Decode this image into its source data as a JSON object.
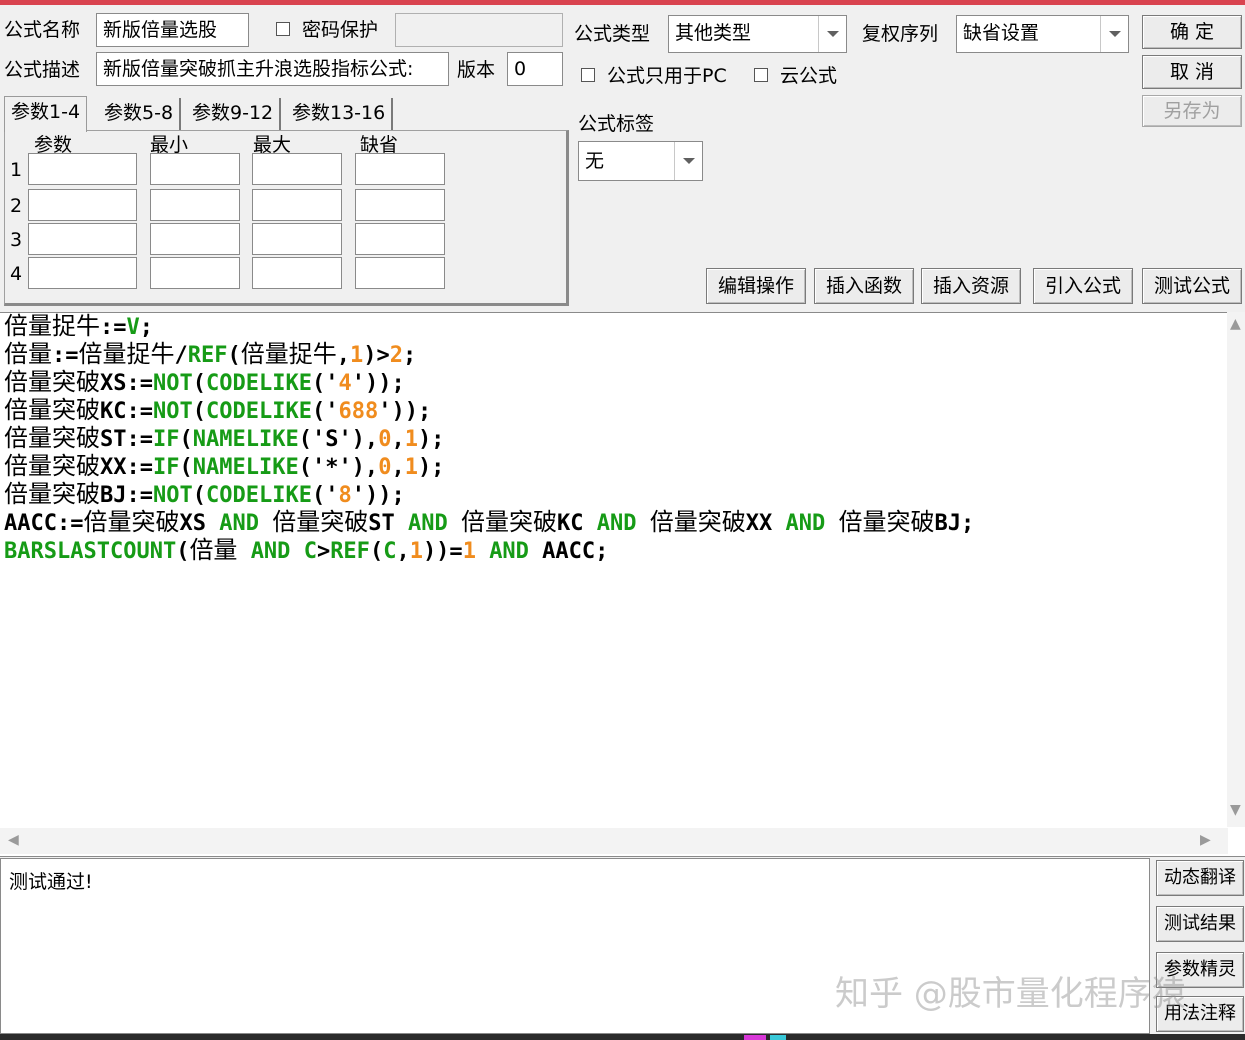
{
  "header": {
    "name_label": "公式名称",
    "name_value": "新版倍量选股",
    "password_label": "密码保护",
    "password_value": "",
    "desc_label": "公式描述",
    "desc_value": "新版倍量突破抓主升浪选股指标公式:",
    "version_label": "版本",
    "version_value": "0",
    "type_label": "公式类型",
    "type_value": "其他类型",
    "restore_label": "复权序列",
    "restore_value": "缺省设置",
    "pc_only_label": "公式只用于PC",
    "cloud_label": "云公式",
    "tag_label": "公式标签",
    "tag_value": "无"
  },
  "buttons": {
    "ok": "确 定",
    "cancel": "取 消",
    "save_as": "另存为",
    "edit_ops": "编辑操作",
    "insert_func": "插入函数",
    "insert_res": "插入资源",
    "import_formula": "引入公式",
    "test_formula": "测试公式",
    "dyn_translate": "动态翻译",
    "test_result": "测试结果",
    "param_wizard": "参数精灵",
    "usage_notes": "用法注释"
  },
  "param_tabs": [
    "参数1-4",
    "参数5-8",
    "参数9-12",
    "参数13-16"
  ],
  "param_columns": [
    "参数",
    "最小",
    "最大",
    "缺省"
  ],
  "param_rows": [
    "1",
    "2",
    "3",
    "4"
  ],
  "code_lines": [
    [
      [
        "c",
        "倍量捉牛"
      ],
      [
        "k",
        ":="
      ],
      [
        "g",
        "V"
      ],
      [
        "k",
        ";"
      ]
    ],
    [
      [
        "c",
        "倍量"
      ],
      [
        "k",
        ":="
      ],
      [
        "c",
        "倍量捉牛"
      ],
      [
        "k",
        "/"
      ],
      [
        "g",
        "REF"
      ],
      [
        "k",
        "("
      ],
      [
        "c",
        "倍量捉牛"
      ],
      [
        "k",
        ","
      ],
      [
        "o",
        "1"
      ],
      [
        "k",
        ")>"
      ],
      [
        "o",
        "2"
      ],
      [
        "k",
        ";"
      ]
    ],
    [
      [
        "c",
        "倍量突破"
      ],
      [
        "k",
        "XS:="
      ],
      [
        "g",
        "NOT"
      ],
      [
        "k",
        "("
      ],
      [
        "g",
        "CODELIKE"
      ],
      [
        "k",
        "('"
      ],
      [
        "o",
        "4"
      ],
      [
        "k",
        "'));"
      ]
    ],
    [
      [
        "c",
        "倍量突破"
      ],
      [
        "k",
        "KC:="
      ],
      [
        "g",
        "NOT"
      ],
      [
        "k",
        "("
      ],
      [
        "g",
        "CODELIKE"
      ],
      [
        "k",
        "('"
      ],
      [
        "o",
        "688"
      ],
      [
        "k",
        "'));"
      ]
    ],
    [
      [
        "c",
        "倍量突破"
      ],
      [
        "k",
        "ST:="
      ],
      [
        "g",
        "IF"
      ],
      [
        "k",
        "("
      ],
      [
        "g",
        "NAMELIKE"
      ],
      [
        "k",
        "('S'),"
      ],
      [
        "o",
        "0"
      ],
      [
        "k",
        ","
      ],
      [
        "o",
        "1"
      ],
      [
        "k",
        ");"
      ]
    ],
    [
      [
        "c",
        "倍量突破"
      ],
      [
        "k",
        "XX:="
      ],
      [
        "g",
        "IF"
      ],
      [
        "k",
        "("
      ],
      [
        "g",
        "NAMELIKE"
      ],
      [
        "k",
        "('*'),"
      ],
      [
        "o",
        "0"
      ],
      [
        "k",
        ","
      ],
      [
        "o",
        "1"
      ],
      [
        "k",
        ");"
      ]
    ],
    [
      [
        "c",
        "倍量突破"
      ],
      [
        "k",
        "BJ:="
      ],
      [
        "g",
        "NOT"
      ],
      [
        "k",
        "("
      ],
      [
        "g",
        "CODELIKE"
      ],
      [
        "k",
        "('"
      ],
      [
        "o",
        "8"
      ],
      [
        "k",
        "'));"
      ]
    ],
    [
      [
        "k",
        "AACC:="
      ],
      [
        "c",
        "倍量突破"
      ],
      [
        "k",
        "XS "
      ],
      [
        "g",
        "AND"
      ],
      [
        "k",
        " "
      ],
      [
        "c",
        "倍量突破"
      ],
      [
        "k",
        "ST "
      ],
      [
        "g",
        "AND"
      ],
      [
        "k",
        " "
      ],
      [
        "c",
        "倍量突破"
      ],
      [
        "k",
        "KC "
      ],
      [
        "g",
        "AND"
      ],
      [
        "k",
        " "
      ],
      [
        "c",
        "倍量突破"
      ],
      [
        "k",
        "XX "
      ],
      [
        "g",
        "AND"
      ],
      [
        "k",
        " "
      ],
      [
        "c",
        "倍量突破"
      ],
      [
        "k",
        "BJ;"
      ]
    ],
    [
      [
        "g",
        "BARSLASTCOUNT"
      ],
      [
        "k",
        "("
      ],
      [
        "c",
        "倍量"
      ],
      [
        "k",
        " "
      ],
      [
        "g",
        "AND"
      ],
      [
        "k",
        " "
      ],
      [
        "g",
        "C"
      ],
      [
        "k",
        ">"
      ],
      [
        "g",
        "REF"
      ],
      [
        "k",
        "("
      ],
      [
        "g",
        "C"
      ],
      [
        "k",
        ","
      ],
      [
        "o",
        "1"
      ],
      [
        "k",
        "))="
      ],
      [
        "o",
        "1"
      ],
      [
        "k",
        " "
      ],
      [
        "g",
        "AND"
      ],
      [
        "k",
        " AACC;"
      ]
    ]
  ],
  "code_colors": {
    "k": "#000000",
    "g": "#169b16",
    "o": "#f08c1e",
    "c": "#000000"
  },
  "output_text": "测试通过!",
  "watermark": "知乎 @股市量化程序猿"
}
